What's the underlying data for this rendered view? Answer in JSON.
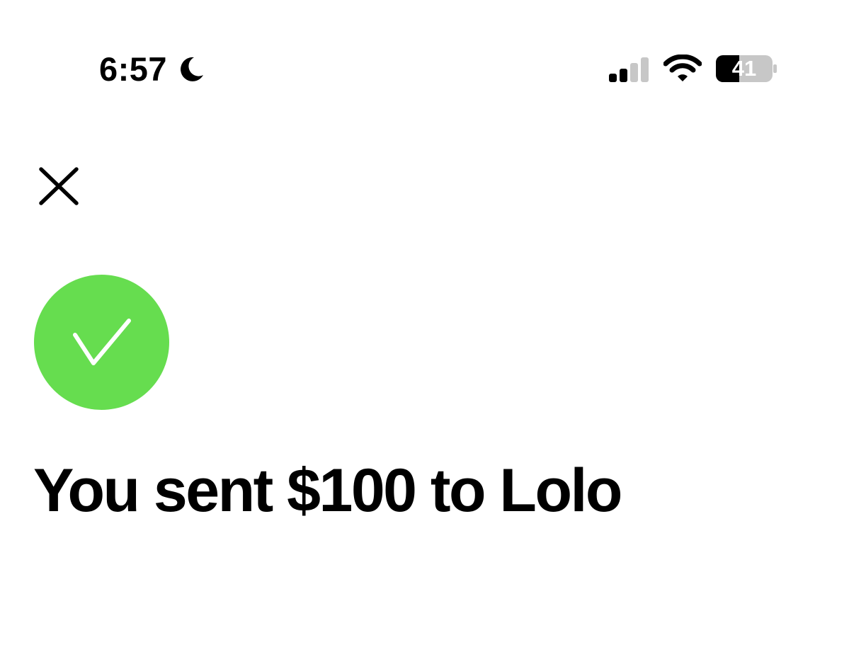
{
  "status_bar": {
    "time": "6:57",
    "focus_icon": "moon-icon",
    "signal_icon": "cellular-signal-icon",
    "signal_bars_active": 2,
    "signal_bars_total": 4,
    "wifi_icon": "wifi-icon",
    "battery_icon": "battery-icon",
    "battery_percent": "41",
    "battery_level": 0.41
  },
  "header": {
    "close_icon": "close-icon"
  },
  "confirmation": {
    "status_icon": "checkmark-circle-icon",
    "headline": "You sent $100 to Lolo"
  },
  "colors": {
    "background": "#ffffff",
    "text": "#000000",
    "success": "#66dd4f",
    "inactive_gray": "#c7c7c7"
  }
}
